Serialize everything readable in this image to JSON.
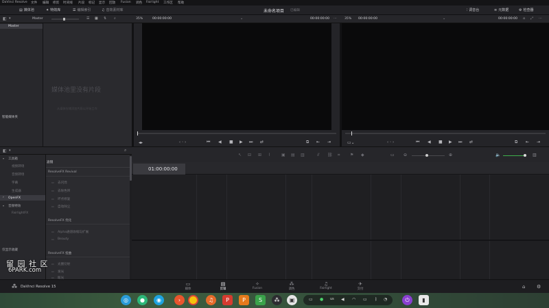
{
  "menubar": {
    "items": [
      "DaVinci Resolve",
      "文件",
      "编辑",
      "修剪",
      "时间线",
      "片段",
      "标记",
      "显示",
      "回放",
      "Fusion",
      "调色",
      "Fairlight",
      "工作区",
      "帮助"
    ]
  },
  "toolbar": {
    "media_pool": "媒体池",
    "effects": "特效库",
    "edit_index": "编辑索引",
    "sound_library": "音效素材库",
    "project_title": "未命名项目",
    "edited_status": "已编辑",
    "mixer": "调音台",
    "metadata": "元数据",
    "inspector": "检查器"
  },
  "viewer": {
    "bin_name": "Master",
    "source_zoom": "35%",
    "source_timecode": "00:00:00:00",
    "source_duration": "00:00:00:00",
    "timeline_zoom": "35%",
    "timeline_timecode": "00:00:00:00",
    "timeline_duration": "00:00:00:00"
  },
  "media_pool": {
    "bins": [
      "Master"
    ],
    "smart_bins_label": "智能媒体夹",
    "empty_title": "媒体池里没有片段",
    "empty_hint": "从媒体存储添加片段以开始工作"
  },
  "effects": {
    "tree": [
      {
        "label": "工具箱",
        "expanded": true
      },
      {
        "label": "视频转场",
        "sub": true
      },
      {
        "label": "音频转场",
        "sub": true
      },
      {
        "label": "字幕",
        "sub": true
      },
      {
        "label": "生成器",
        "sub": true
      },
      {
        "label": "OpenFX",
        "selected": true
      },
      {
        "label": "音频特效",
        "expanded": true
      },
      {
        "label": "FairlightFX",
        "sub": true
      }
    ],
    "favorites_label": "仅显示收藏",
    "list_header": "滤镜",
    "groups": [
      {
        "title": "ResolveFX Revival",
        "items": [
          "去闪烁",
          "去除色带",
          "坏点修复",
          "自动除尘"
        ]
      },
      {
        "title": "ResolveFX 优化",
        "items": [
          "Alpha通道收缩与扩展",
          "Beauty"
        ]
      },
      {
        "title": "ResolveFX 扭曲",
        "items": [
          "光圈衍射",
          "发光",
          "眩光"
        ]
      }
    ]
  },
  "timeline": {
    "timecode": "01:00:00:00"
  },
  "page_tabs": [
    {
      "label": "媒体",
      "icon": "media-icon"
    },
    {
      "label": "剪辑",
      "icon": "edit-icon",
      "active": true
    },
    {
      "label": "Fusion",
      "icon": "fusion-icon"
    },
    {
      "label": "调色",
      "icon": "color-icon"
    },
    {
      "label": "Fairlight",
      "icon": "fairlight-icon"
    },
    {
      "label": "交付",
      "icon": "deliver-icon"
    }
  ],
  "app_footer": {
    "name": "DaVinci Resolve 15"
  },
  "watermark": {
    "line1": "留 园 社 区",
    "line2": "6PARK.com"
  },
  "dock": {
    "tray_text": "us"
  }
}
